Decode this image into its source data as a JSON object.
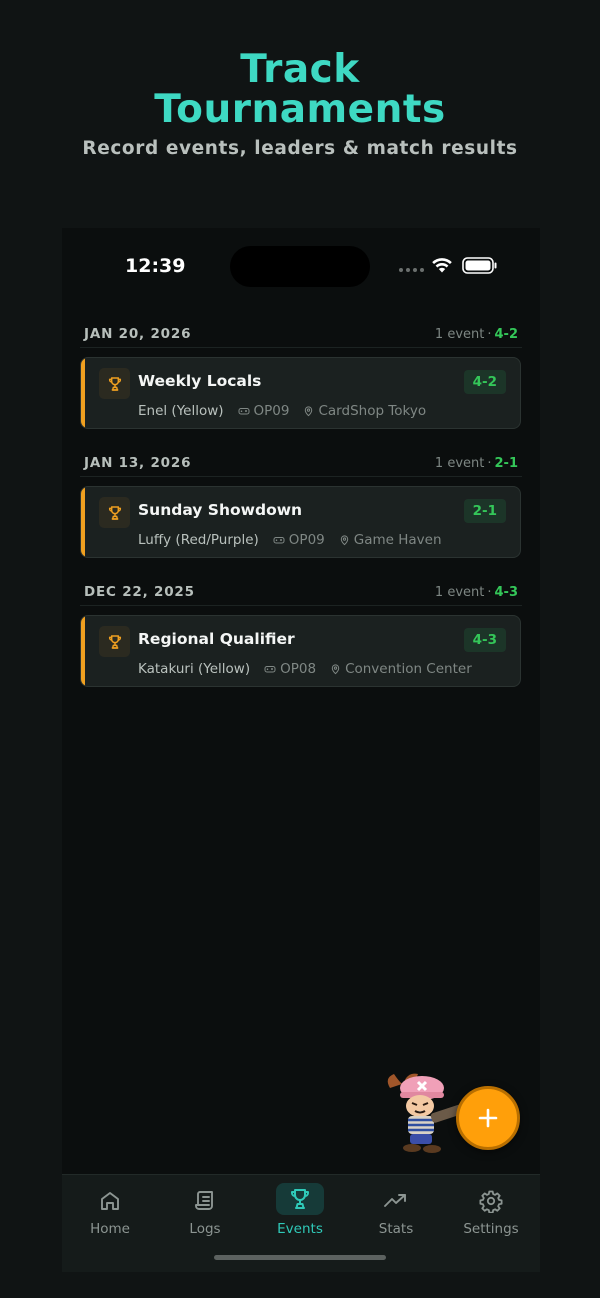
{
  "promo": {
    "title_line1": "Track",
    "title_line2": "Tournaments",
    "subtitle": "Record events, leaders & match results"
  },
  "status_bar": {
    "time": "12:39"
  },
  "groups": [
    {
      "date": "JAN 20, 2026",
      "summary_count": "1 event",
      "summary_sep": "·",
      "summary_record": "4-2",
      "events": [
        {
          "name": "Weekly Locals",
          "record": "4-2",
          "leader": "Enel (Yellow)",
          "set": "OP09",
          "location": "CardShop Tokyo"
        }
      ]
    },
    {
      "date": "JAN 13, 2026",
      "summary_count": "1 event",
      "summary_sep": "·",
      "summary_record": "2-1",
      "events": [
        {
          "name": "Sunday Showdown",
          "record": "2-1",
          "leader": "Luffy (Red/Purple)",
          "set": "OP09",
          "location": "Game Haven"
        }
      ]
    },
    {
      "date": "DEC 22, 2025",
      "summary_count": "1 event",
      "summary_sep": "·",
      "summary_record": "4-3",
      "events": [
        {
          "name": "Regional Qualifier",
          "record": "4-3",
          "leader": "Katakuri (Yellow)",
          "set": "OP08",
          "location": "Convention Center"
        }
      ]
    }
  ],
  "fab": {
    "icon": "plus-icon",
    "symbol": "+"
  },
  "tabbar": {
    "active": "Events",
    "tabs": [
      {
        "label": "Home",
        "icon": "home-icon"
      },
      {
        "label": "Logs",
        "icon": "scroll-icon"
      },
      {
        "label": "Events",
        "icon": "trophy-icon"
      },
      {
        "label": "Stats",
        "icon": "trend-up-icon"
      },
      {
        "label": "Settings",
        "icon": "gear-icon"
      }
    ]
  },
  "colors": {
    "accent_teal": "#3ed9c3",
    "win_green": "#34c759",
    "event_orange": "#f0a020",
    "fab_orange": "#ff9f0a",
    "background": "#0b0e0e"
  }
}
